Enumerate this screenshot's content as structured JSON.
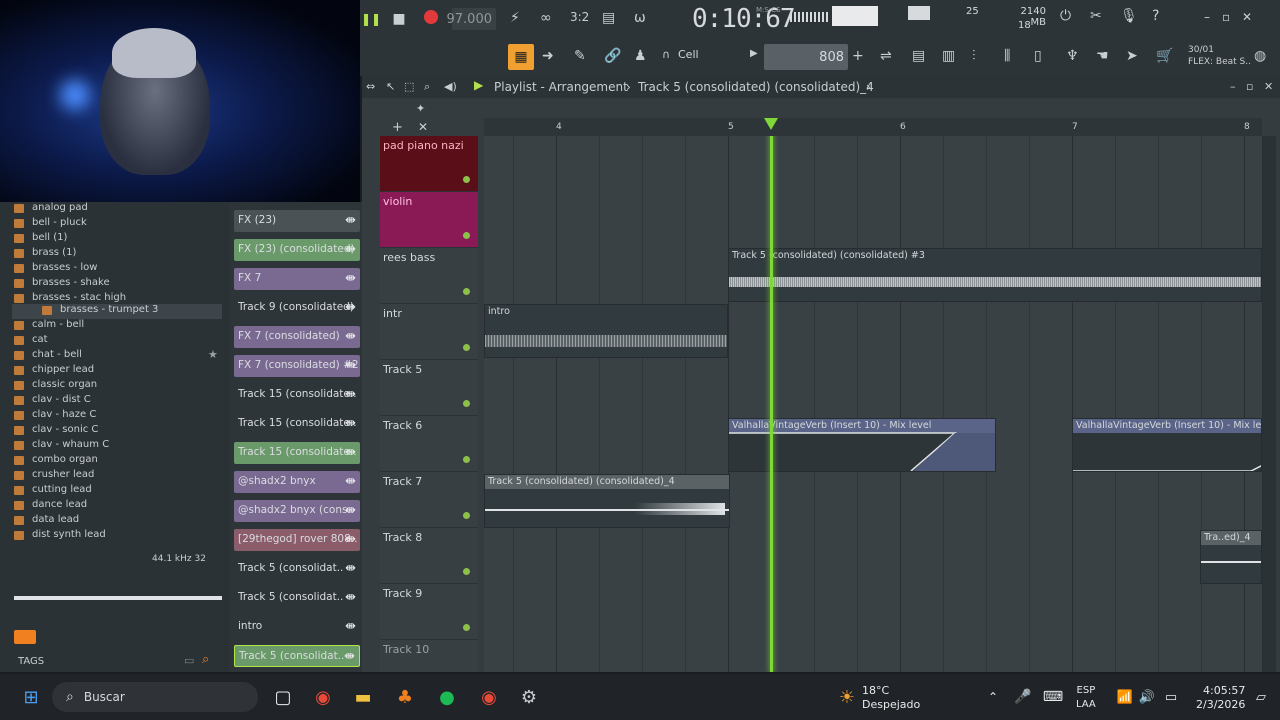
{
  "transport": {
    "tempo": "97.000",
    "time": "0:10:67",
    "time_label": "M:S:CS",
    "pattern": "808",
    "snap": "Cell",
    "cpu": "25",
    "ram": "2140 MB",
    "voices": "18",
    "flex_line1": "30/01",
    "flex_line2": "FLEX: Beat S.."
  },
  "playlist": {
    "title": "Playlist - Arrangement",
    "subtitle": "Track 5 (consolidated) (consolidated)_4",
    "ruler": [
      "4",
      "5",
      "6",
      "7",
      "8"
    ]
  },
  "browser": {
    "items": [
      "analog pad",
      "bell - pluck",
      "bell (1)",
      "brass (1)",
      "brasses - low",
      "brasses - shake",
      "brasses - stac high",
      "brasses - trumpet 3",
      "calm - bell",
      "cat",
      "chat - bell",
      "chipper lead",
      "classic organ",
      "clav - dist C",
      "clav - haze C",
      "clav - sonic C",
      "clav - whaum C",
      "combo organ",
      "crusher lead",
      "cutting lead",
      "dance lead",
      "data lead",
      "dist synth lead"
    ],
    "freq": "44.1 kHz 32",
    "tags": "TAGS"
  },
  "channels": [
    {
      "label": "FX (23)",
      "style": "gray"
    },
    {
      "label": "FX (23) (consolidated)",
      "style": "green"
    },
    {
      "label": "FX 7",
      "style": "purple"
    },
    {
      "label": "Track 9 (consolidated)",
      "style": "none"
    },
    {
      "label": "FX 7 (consolidated)",
      "style": "purple"
    },
    {
      "label": "FX 7 (consolidated) #2",
      "style": "purple"
    },
    {
      "label": "Track 15 (consolidate..",
      "style": "none"
    },
    {
      "label": "Track 15 (consolidate..",
      "style": "none"
    },
    {
      "label": "Track 15 (consolidate..",
      "style": "green"
    },
    {
      "label": "@shadx2 bnyx",
      "style": "purple"
    },
    {
      "label": "@shadx2 bnyx (cons..",
      "style": "purple"
    },
    {
      "label": "[29thegod] rover 808..",
      "style": "rose"
    },
    {
      "label": "Track 5 (consolidat..",
      "style": "none"
    },
    {
      "label": "Track 5 (consolidat..",
      "style": "none"
    },
    {
      "label": "intro",
      "style": "none"
    },
    {
      "label": "Track 5 (consolidat..",
      "style": "green"
    }
  ],
  "tracks": [
    "pad piano nazi",
    "violin",
    "rees bass",
    "intr",
    "Track 5",
    "Track 6",
    "Track 7",
    "Track 8",
    "Track 9",
    "Track 10"
  ],
  "clips": {
    "rees": "Track 5 (consolidated) (consolidated) #3",
    "intro": "intro",
    "valhalla1": "ValhallaVintageVerb (Insert 10) - Mix level",
    "valhalla2": "ValhallaVintageVerb (Insert 10) - Mix level",
    "track7": "Track 5 (consolidated) (consolidated)_4",
    "track8": "Tra..ed)_4"
  },
  "taskbar": {
    "search": "Buscar",
    "weather_temp": "18°C",
    "weather_desc": "Despejado",
    "lang1": "ESP",
    "lang2": "LAA",
    "time": "4:05:57",
    "date": "2/3/2026"
  },
  "colors": {
    "accent": "#7fd838",
    "orange": "#f0a030"
  }
}
